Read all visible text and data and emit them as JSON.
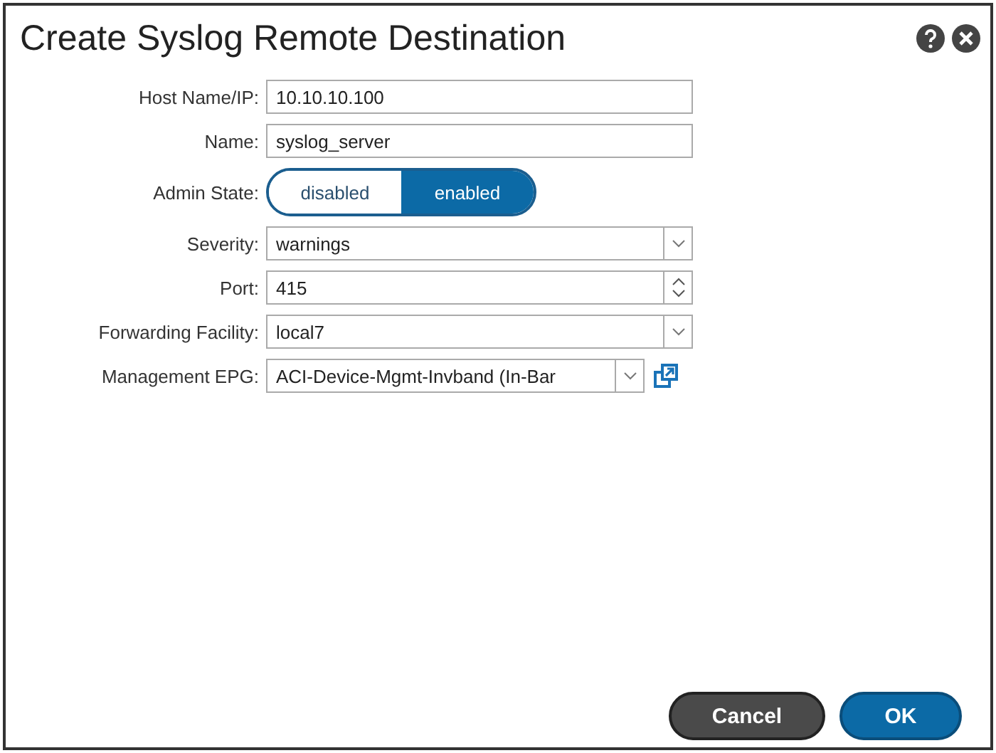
{
  "dialog": {
    "title": "Create Syslog Remote Destination"
  },
  "fields": [
    {
      "kind": "text",
      "label": "Host Name/IP:",
      "value": "10.10.10.100"
    },
    {
      "kind": "text",
      "label": "Name:",
      "value": "syslog_server"
    },
    {
      "kind": "toggle",
      "label": "Admin State:",
      "options": [
        {
          "label": "disabled",
          "selected": false
        },
        {
          "label": "enabled",
          "selected": true
        }
      ]
    },
    {
      "kind": "select",
      "label": "Severity:",
      "value": "warnings"
    },
    {
      "kind": "spinner",
      "label": "Port:",
      "value": "415"
    },
    {
      "kind": "select",
      "label": "Forwarding Facility:",
      "value": "local7"
    },
    {
      "kind": "select-link",
      "label": "Management EPG:",
      "value": "ACI-Device-Mgmt-Invband (In-Bar"
    }
  ],
  "buttons": [
    {
      "kind": "secondary",
      "label": "Cancel"
    },
    {
      "kind": "primary",
      "label": "OK"
    }
  ]
}
